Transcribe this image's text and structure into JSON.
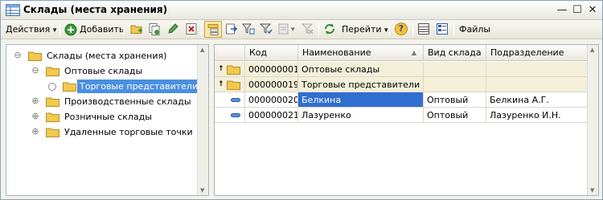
{
  "window": {
    "title": "Склады (места хранения)",
    "controls": {
      "minimize": "—",
      "maximize": "☐",
      "close": "✕"
    }
  },
  "toolbar": {
    "actions_label": "Действия",
    "add_label": "Добавить",
    "goto_label": "Перейти",
    "files_label": "Файлы",
    "dropdown_glyph": "▾",
    "help_glyph": "?"
  },
  "tree": {
    "root": {
      "label": "Склады (места хранения)",
      "expander": "⊖"
    },
    "items": [
      {
        "label": "Оптовые склады",
        "expander": "⊖"
      },
      {
        "label": "Торговые представители",
        "selected": true
      },
      {
        "label": "Производственные склады",
        "expander": "⊕"
      },
      {
        "label": "Розничные склады",
        "expander": "⊕"
      },
      {
        "label": "Удаленные торговые точки",
        "expander": "⊕"
      }
    ]
  },
  "table": {
    "columns": [
      "Код",
      "Наименование",
      "Вид склада",
      "Подразделение"
    ],
    "sort_glyph": "▲",
    "rows": [
      {
        "type": "group",
        "marker": "↑",
        "code": "000000001",
        "name": "Оптовые склады",
        "kind": "",
        "dept": ""
      },
      {
        "type": "group",
        "marker": "↑",
        "code": "000000019",
        "name": "Торговые представители",
        "kind": "",
        "dept": ""
      },
      {
        "type": "item",
        "code": "000000020",
        "name": "Белкина",
        "kind": "Оптовый",
        "dept": "Белкина А.Г."
      },
      {
        "type": "item",
        "code": "000000021",
        "name": "Лазуренко",
        "kind": "Оптовый",
        "dept": "Лазуренко И.Н."
      }
    ]
  },
  "colors": {
    "selection": "#2f6fd0",
    "folder": "#f1c850",
    "group_row": "#f3efd9",
    "add_icon": "#3a9a3a"
  }
}
